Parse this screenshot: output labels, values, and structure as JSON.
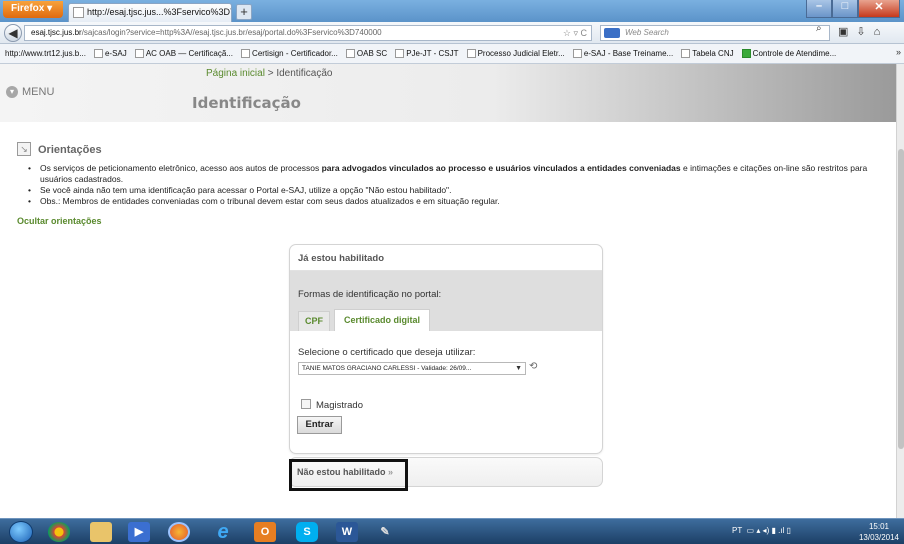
{
  "browser": {
    "app_button": "Firefox",
    "tab_title": "http://esaj.tjsc.jus...%3Fservico%3D740000",
    "new_tab": "+",
    "url_host": "esaj.tjsc.jus.br",
    "url_rest": "/sajcas/login?service=http%3A//esaj.tjsc.jus.br/esaj/portal.do%3Fservico%3D740000",
    "url_right_icons": "☆ ▿ C",
    "search_placeholder": "Web Search",
    "window_controls": {
      "minimize": "–",
      "maximize": "□",
      "close": "✕"
    }
  },
  "bookmarks": [
    "http://www.trt12.jus.b...",
    "e-SAJ",
    "AC OAB — Certificaçã...",
    "Certisign - Certificador...",
    "OAB SC",
    "PJe-JT - CSJT",
    "Processo Judicial Eletr...",
    "e-SAJ - Base Treiname...",
    "Tabela CNJ",
    "Controle de Atendime..."
  ],
  "page": {
    "breadcrumb_home": "Página inicial",
    "breadcrumb_sep": " > ",
    "breadcrumb_current": "Identificação",
    "menu_label": "MENU",
    "title": "Identificação",
    "orientations_title": "Orientações",
    "orientations": {
      "item1_a": "Os serviços de peticionamento eletrônico, acesso aos autos de processos ",
      "item1_bold": "para advogados vinculados ao processo e usuários vinculados a entidades conveniadas",
      "item1_b": " e intimações e citações on-line são restritos para usuários cadastrados.",
      "item2": "Se você ainda não tem uma identificação para acessar o Portal e-SAJ, utilize a opção \"Não estou habilitado\".",
      "item3": "Obs.: Membros de entidades conveniadas com o tribunal devem estar com seus dados atualizados e em situação regular."
    },
    "hide_orientations": "Ocultar orientações"
  },
  "login": {
    "header": "Já estou habilitado",
    "forms_label": "Formas de identificação no portal:",
    "tabs": [
      "CPF",
      "Certificado digital"
    ],
    "select_label": "Selecione o certificado que deseja utilizar:",
    "certificate_value": "TANIE MATOS GRACIANO CARLESSI - Validade: 26/09...",
    "magistrado_label": "Magistrado",
    "enter_button": "Entrar",
    "not_enabled": "Não estou habilitado",
    "not_enabled_chevron": "»"
  },
  "taskbar": {
    "tray_lang": "PT",
    "clock_time": "15:01",
    "clock_date": "13/03/2014"
  }
}
